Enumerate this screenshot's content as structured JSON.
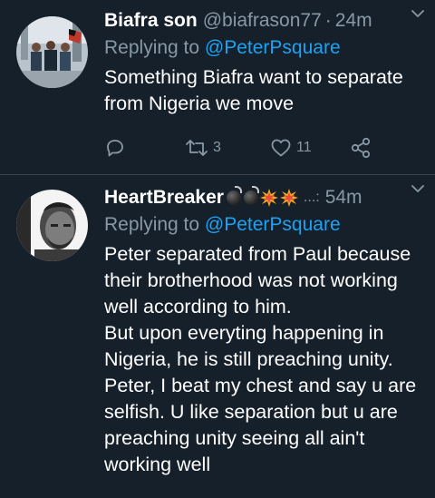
{
  "tweets": [
    {
      "display_name": "Biafra son",
      "handle": "@biafrason77",
      "separator": "·",
      "time": "24m",
      "reply_prefix": "Replying to ",
      "reply_to": "@PeterPsquare",
      "body_lines": [
        "Something Biafra want to separate",
        "from Nigeria we move"
      ],
      "actions": {
        "reply_icon": "reply-icon",
        "retweet_icon": "retweet-icon",
        "retweet_count": "3",
        "like_icon": "heart-icon",
        "like_count": "11",
        "share_icon": "share-icon"
      }
    },
    {
      "display_name": "HeartBreaker",
      "name_emojis": [
        "bomb",
        "bomb",
        "collision",
        "collision"
      ],
      "handle_truncated": "...:",
      "time": "54m",
      "reply_prefix": "Replying to ",
      "reply_to": "@PeterPsquare",
      "body_lines": [
        "Peter separated from Paul because",
        "their brotherhood was not working",
        "well according to him.",
        "But upon everyting happening in",
        "Nigeria, he is still preaching unity.",
        "Peter, I beat my chest and say u are",
        "selfish. U like separation but u are",
        "preaching unity seeing all ain't",
        "working well"
      ]
    }
  ],
  "colors": {
    "background": "#15202b",
    "secondary_text": "#8899a6",
    "mention": "#1da1f2",
    "divider": "#38444d"
  }
}
